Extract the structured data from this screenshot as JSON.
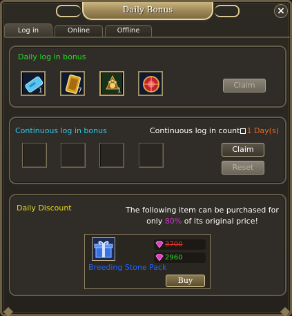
{
  "window": {
    "title": "Daily Bonus",
    "close_label": "×"
  },
  "tabs": [
    {
      "label": "Log in",
      "active": true
    },
    {
      "label": "Online",
      "active": false
    },
    {
      "label": "Offline",
      "active": false
    }
  ],
  "daily_login": {
    "title": "Daily log in bonus",
    "items": [
      {
        "icon": "blue-ticket-icon",
        "count": "1"
      },
      {
        "icon": "golden-card-icon",
        "count": "7"
      },
      {
        "icon": "paw-emblem-icon",
        "count": "1"
      },
      {
        "icon": "red-orb-icon",
        "count": ""
      }
    ],
    "claim_label": "Claim"
  },
  "continuous_login": {
    "title": "Continuous log in bonus",
    "count_label": "Continuous log in count",
    "count_value": "1 Day(s)",
    "claim_label": "Claim",
    "reset_label": "Reset"
  },
  "daily_discount": {
    "title": "Daily Discount",
    "text_line1": "The following item can be purchased for",
    "text_prefix": "only ",
    "percent": "80%",
    "text_suffix": " of its original price!",
    "item_name": "Breeding Stone Pack",
    "item_icon": "gift-box-icon",
    "original_price": "3700",
    "discount_price": "2960",
    "buy_label": "Buy"
  },
  "colors": {
    "green_title": "#22dd22",
    "cyan_title": "#33c8e8",
    "yellow_title": "#e8d820",
    "orange_value": "#e86a20",
    "magenta_percent": "#cc33cc",
    "item_name_blue": "#2266ff",
    "price_red": "#e83333",
    "price_green": "#33dd33"
  }
}
